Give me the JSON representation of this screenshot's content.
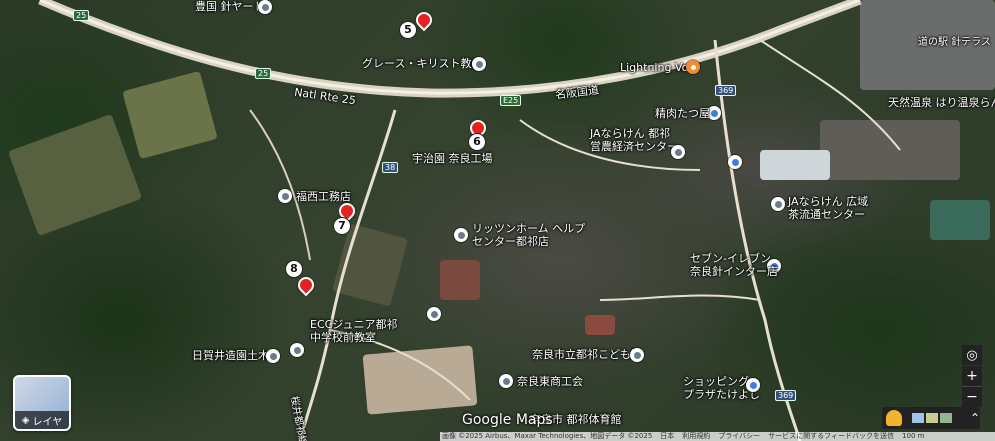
{
  "map": {
    "places": [
      {
        "key": "toyokuni",
        "label": "豊国 針ヤード"
      },
      {
        "key": "grace",
        "label": "グレース・キリスト教会"
      },
      {
        "key": "lightning",
        "label": "Lightning Volt"
      },
      {
        "key": "michinoeki",
        "label": "道の駅 針テラス"
      },
      {
        "key": "onsen",
        "label": "天然温泉 はり温泉らん"
      },
      {
        "key": "seiniku",
        "label": "精肉たつ屋"
      },
      {
        "key": "ja1",
        "label": "JAならけん 都祁\n営農経済センター"
      },
      {
        "key": "ujien",
        "label": "宇治園 奈良工場"
      },
      {
        "key": "ja2",
        "label": "JAならけん 広域\n茶流通センター"
      },
      {
        "key": "fukunishi",
        "label": "福西工務店"
      },
      {
        "key": "ritsuzan",
        "label": "リッツンホーム ヘルプ\nセンター都祁店"
      },
      {
        "key": "seven",
        "label": "セブン-イレブン\n奈良針インター店"
      },
      {
        "key": "ecc",
        "label": "ECCジュニア都祁\n中学校前教室"
      },
      {
        "key": "higai",
        "label": "日賀井造園土木"
      },
      {
        "key": "kodomoen",
        "label": "奈良市立都祁こども園"
      },
      {
        "key": "shokokai",
        "label": "奈良東商工会"
      },
      {
        "key": "shopping",
        "label": "ショッピング\nプラザたけよし"
      },
      {
        "key": "gym",
        "label": "奈良市 都祁体育館"
      },
      {
        "key": "sakurai",
        "label": "桜井都祁線"
      }
    ],
    "roads": {
      "natl_rte": "Natl Rte 25",
      "meihan": "名阪国道",
      "shield_25a": "25",
      "shield_25b": "25",
      "shield_e25": "E25",
      "shield_38": "38",
      "shield_369a": "369",
      "shield_369b": "369"
    },
    "markers": [
      "5",
      "6",
      "7",
      "8"
    ],
    "layer_button": "レイヤ",
    "zoom_in": "+",
    "zoom_out": "−",
    "logo": "Google Maps",
    "attribution": [
      "画像 ©2025 Airbus、Maxar Technologies、地図データ ©2025",
      "日本",
      "利用規約",
      "プライバシー",
      "サービスに関するフィードバックを送信",
      "100 m"
    ]
  },
  "colors": {
    "pin": "#e3231f",
    "poi_blue": "#3f7ddb",
    "poi_orange": "#f28a2e"
  }
}
